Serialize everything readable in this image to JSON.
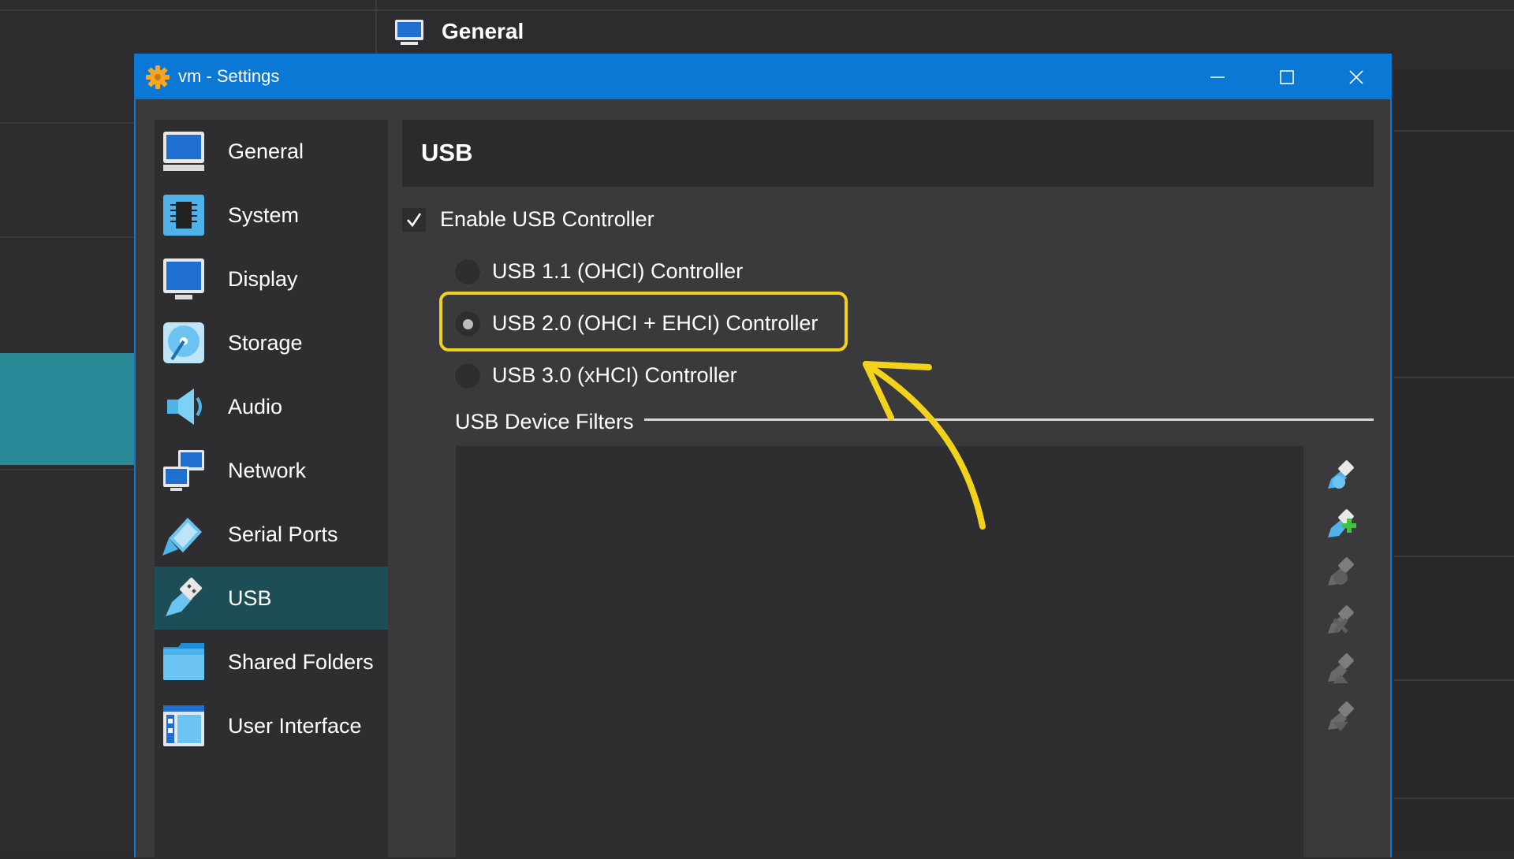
{
  "background_window": {
    "header_title": "General"
  },
  "dialog": {
    "title": "vm - Settings",
    "window_buttons": [
      "minimize",
      "maximize",
      "close"
    ]
  },
  "sidebar": {
    "selected": "USB",
    "items": [
      {
        "label": "General",
        "icon": "general-monitor-icon"
      },
      {
        "label": "System",
        "icon": "system-chip-icon"
      },
      {
        "label": "Display",
        "icon": "display-monitor-icon"
      },
      {
        "label": "Storage",
        "icon": "storage-disk-icon"
      },
      {
        "label": "Audio",
        "icon": "audio-speaker-icon"
      },
      {
        "label": "Network",
        "icon": "network-monitors-icon"
      },
      {
        "label": "Serial Ports",
        "icon": "serial-port-icon"
      },
      {
        "label": "USB",
        "icon": "usb-plug-icon"
      },
      {
        "label": "Shared Folders",
        "icon": "folder-icon"
      },
      {
        "label": "User Interface",
        "icon": "user-interface-icon"
      }
    ]
  },
  "page": {
    "title": "USB",
    "enable_usb": {
      "label": "Enable USB Controller",
      "checked": true
    },
    "controllers": [
      {
        "label": "USB 1.1 (OHCI) Controller",
        "selected": false
      },
      {
        "label": "USB 2.0 (OHCI + EHCI) Controller",
        "selected": true
      },
      {
        "label": "USB 3.0 (xHCI) Controller",
        "selected": false
      }
    ],
    "filters_label": "USB Device Filters",
    "filter_tools": [
      {
        "icon": "add-empty-filter-icon",
        "enabled": true
      },
      {
        "icon": "add-filter-from-device-icon",
        "enabled": true
      },
      {
        "icon": "edit-filter-icon",
        "enabled": false
      },
      {
        "icon": "remove-filter-icon",
        "enabled": false
      },
      {
        "icon": "move-filter-up-icon",
        "enabled": false
      },
      {
        "icon": "move-filter-down-icon",
        "enabled": false
      }
    ]
  },
  "annotation": {
    "highlight_color": "#f2d21b",
    "accent_color": "#0a78d4"
  }
}
